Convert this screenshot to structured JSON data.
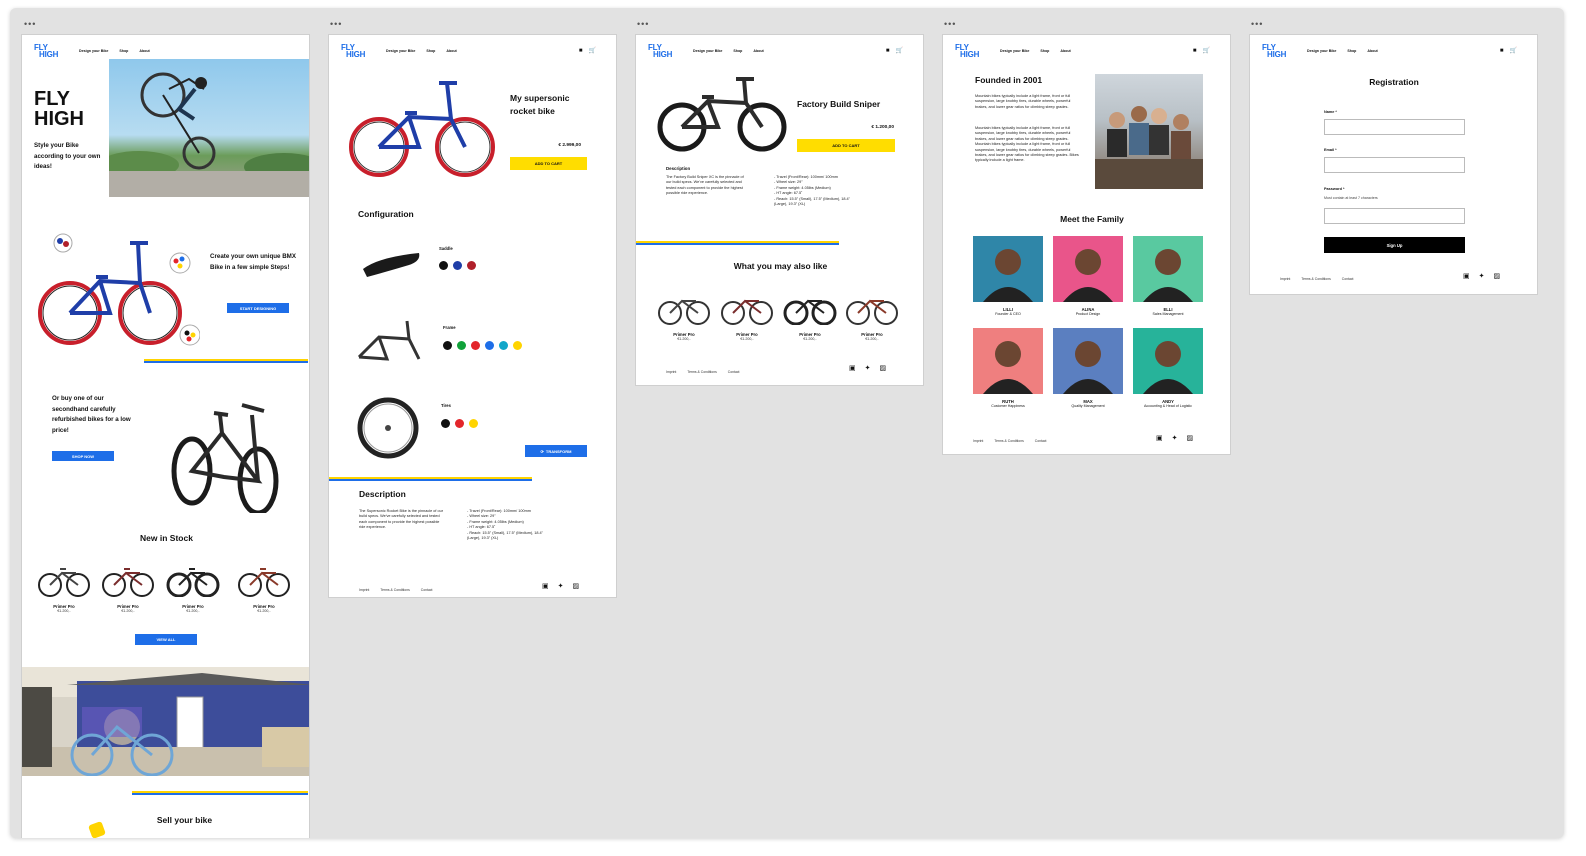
{
  "nav": {
    "logo_line1": "FLY",
    "logo_line2": "HIGH",
    "links": [
      "Design your Bike",
      "Shop",
      "About"
    ],
    "user_icon": "user-icon",
    "cart_icon": "cart-icon"
  },
  "colors": {
    "blue": "#1e6ee8",
    "yellow": "#ffdd00",
    "red": "#e3262b",
    "green": "#11a23a"
  },
  "frame_dots": "•••",
  "home": {
    "hero_title_1": "FLY",
    "hero_title_2": "HIGH",
    "hero_subtitle": "Style your Bike according to your own ideas!",
    "design_text": "Create your own unique BMX Bike in a few simple Steps!",
    "design_button": "START DESIGNING",
    "secondhand_text": "Or buy one of our secondhand carefully refurbished bikes for a low price!",
    "shop_button": "SHOP NOW",
    "new_in_stock": "New in Stock",
    "products": [
      {
        "name": "Primer Pro",
        "price": "€1.200,-"
      },
      {
        "name": "Primer Pro",
        "price": "€1.200,-"
      },
      {
        "name": "Primer Pro",
        "price": "€1.200,-"
      },
      {
        "name": "Primer Pro",
        "price": "€1.200,-"
      }
    ],
    "view_all": "VIEW ALL",
    "sell_title": "Sell your bike"
  },
  "configurator": {
    "title": "My supersonic rocket bike",
    "price": "€ 2.999,00",
    "add_to_cart": "ADD TO CART",
    "config_title": "Configuration",
    "saddle_label": "Saddle",
    "frame_label": "Frame",
    "tires_label": "Tires",
    "saddle_colors": [
      "#111111",
      "#1f3ea8",
      "#b0202a"
    ],
    "frame_colors": [
      "#111111",
      "#11a23a",
      "#e3262b",
      "#1e6ee8",
      "#12a6c9",
      "#ffd400"
    ],
    "tires_colors": [
      "#111111",
      "#e3262b",
      "#ffd400"
    ],
    "transform_button": "TRANSFORM",
    "description_title": "Description",
    "description_text": "The Supersonic Rocket Bike is the pinnacle of our build specs. We've carefully selected and tested each component to provide the highest possible ride experience.",
    "specs": [
      "- Travel (Front/Rear): 100mm/ 100mm",
      "- Wheel size: 29\"",
      "- Frame weight: 4.05lbs (Medium)",
      "- HT angle: 67.5˚",
      "- Reach: 15.5\" (Small), 17.5\" (Medium), 18.4\" (Large), 19.3\" (XL)"
    ],
    "footer_links": [
      "Imprint",
      "Terms & Conditions",
      "Contact"
    ]
  },
  "product": {
    "title": "Factory Build Sniper",
    "price": "€ 1.200,00",
    "add_to_cart": "ADD TO CART",
    "description_title": "Description",
    "description_text": "The Factory Build Sniper XC is the pinnacle of our build specs. We've carefully selected and tested each component to provide the highest possible ride experience.",
    "specs": [
      "- Travel (Front/Rear): 100mm/ 100mm",
      "- Wheel size: 29\"",
      "- Frame weight: 4.05lbs (Medium)",
      "- HT angle: 67.5˚",
      "- Reach: 15.5\" (Small), 17.5\" (Medium), 18.4\" (Large), 19.3\" (XL)"
    ],
    "also_like": "What you may also like",
    "products": [
      {
        "name": "Primer Pro",
        "price": "€1.200,-"
      },
      {
        "name": "Primer Pro",
        "price": "€1.200,-"
      },
      {
        "name": "Primer Pro",
        "price": "€1.200,-"
      },
      {
        "name": "Primer Pro",
        "price": "€1.200,-"
      }
    ],
    "footer_links": [
      "Imprint",
      "Terms & Conditions",
      "Contact"
    ]
  },
  "about": {
    "founded_title": "Founded in 2001",
    "para1": "Mountain bikes typically include a light frame, front or full suspension, large knobby tires, durable wheels, powerful brakes, and lower gear ratios for climbing steep grades.",
    "para2": "Mountain bikes typically include a light frame, front or full suspension, large knobby tires, durable wheels, powerful brakes, and lower gear ratios for climbing steep grades. Mountain bikes typically include a light frame, front or full suspension, large knobby tires, durable wheels, powerful brakes, and lower gear ratios for climbing steep grades. Bikes typically include a light frame.",
    "family_title": "Meet the Family",
    "members": [
      {
        "name": "LILLI",
        "role": "Founder & CEO",
        "bg": "#2f86a8"
      },
      {
        "name": "ALINA",
        "role": "Product Design",
        "bg": "#e9558a"
      },
      {
        "name": "ELLI",
        "role": "Sales Management",
        "bg": "#59c9a0"
      },
      {
        "name": "RUTH",
        "role": "Customer Happiness",
        "bg": "#ef7f7f"
      },
      {
        "name": "MAX",
        "role": "Quality Management",
        "bg": "#5b7fc0"
      },
      {
        "name": "ANDY",
        "role": "Accounting & Head of Logistic",
        "bg": "#27b39a"
      }
    ],
    "footer_links": [
      "Imprint",
      "Terms & Conditions",
      "Contact"
    ]
  },
  "registration": {
    "title": "Registration",
    "name_label": "Name *",
    "email_label": "Email *",
    "password_label": "Password *",
    "password_hint": "Must contain at least 7 characters",
    "signup_button": "Sign Up",
    "footer_links": [
      "Imprint",
      "Terms & Conditions",
      "Contact"
    ]
  },
  "icons": {
    "social": [
      "instagram-icon",
      "twitter-icon",
      "facebook-icon"
    ]
  }
}
